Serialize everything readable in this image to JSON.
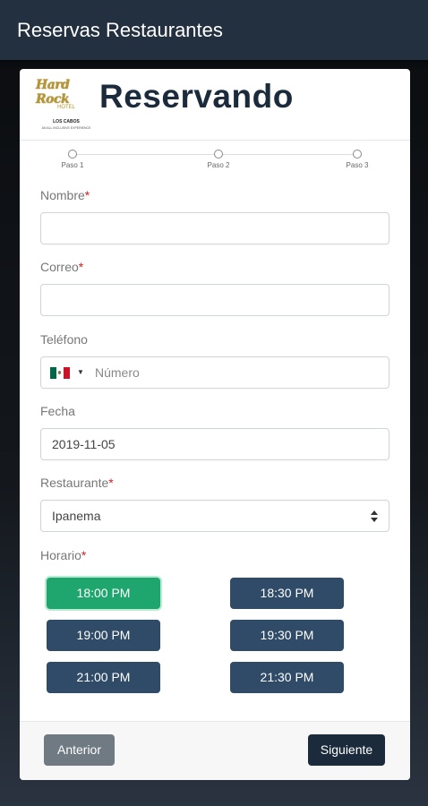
{
  "appbar": {
    "title": "Reservas Restaurantes"
  },
  "header": {
    "logo": {
      "brand": "Hard Rock",
      "hotel": "HOTEL",
      "city": "LOS CABOS",
      "tagline": "AN ALL INCLUSIVE EXPERIENCE"
    },
    "title": "Reservando"
  },
  "stepper": {
    "steps": [
      "Paso 1",
      "Paso 2",
      "Paso 3"
    ]
  },
  "form": {
    "nombre": {
      "label": "Nombre",
      "required": "*",
      "value": ""
    },
    "correo": {
      "label": "Correo",
      "required": "*",
      "value": ""
    },
    "telefono": {
      "label": "Teléfono",
      "placeholder": "Número",
      "flag": "mexico-flag-icon"
    },
    "fecha": {
      "label": "Fecha",
      "value": "2019-11-05"
    },
    "restaurante": {
      "label": "Restaurante",
      "required": "*",
      "value": "Ipanema"
    },
    "horario": {
      "label": "Horario",
      "required": "*",
      "slots": [
        "18:00 PM",
        "18:30 PM",
        "19:00 PM",
        "19:30 PM",
        "21:00 PM",
        "21:30 PM"
      ],
      "selected": "18:00 PM"
    }
  },
  "footer": {
    "prev_label": "Anterior",
    "next_label": "Siguiente"
  },
  "colors": {
    "appbar": "#22303f",
    "primary": "#1c2b3c",
    "slot": "#2f4b67",
    "selected": "#1fa56e",
    "secondary": "#6f7a83",
    "required": "#d42020"
  }
}
